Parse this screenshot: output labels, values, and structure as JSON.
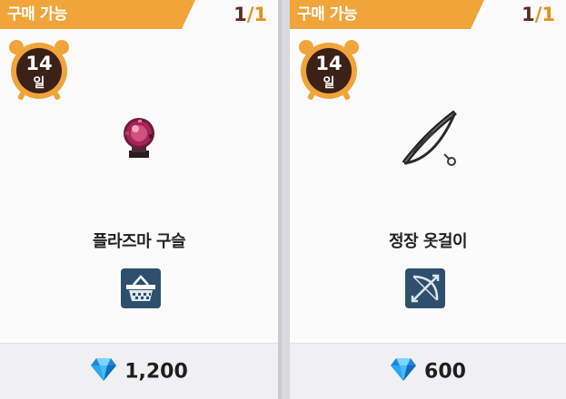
{
  "cards": [
    {
      "status_tag": "구매 가능",
      "stock_current": "1",
      "stock_sep": "/",
      "stock_total": "1",
      "timer_value": "14",
      "timer_unit": "일",
      "item_name": "플라즈마 구슬",
      "item_icon": "plasma-orb-icon",
      "category_icon": "basket-icon",
      "price_icon": "diamond-icon",
      "price": "1,200"
    },
    {
      "status_tag": "구매 가능",
      "stock_current": "1",
      "stock_sep": "/",
      "stock_total": "1",
      "timer_value": "14",
      "timer_unit": "일",
      "item_name": "정장 옷걸이",
      "item_icon": "hanger-bow-icon",
      "category_icon": "bow-arrow-icon",
      "price_icon": "diamond-icon",
      "price": "600"
    }
  ],
  "colors": {
    "tag_orange": "#f0a43a",
    "count_brown": "#5a2e1c",
    "count_orange": "#e68d22",
    "clock_ring": "#f0a43a",
    "clock_face": "#3b2118",
    "category_bg": "#2f4f6e",
    "gem_blue": "#2aa8f2"
  }
}
